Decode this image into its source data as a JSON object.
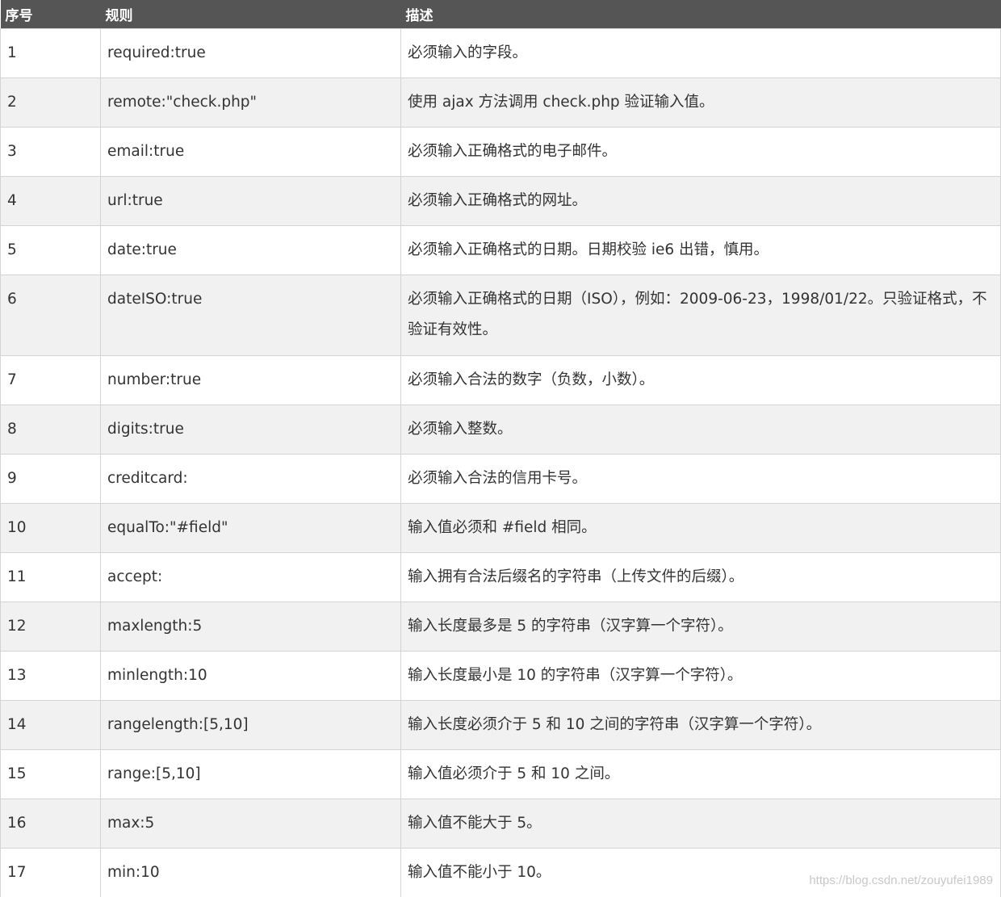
{
  "table": {
    "headers": [
      "序号",
      "规则",
      "描述"
    ],
    "rows": [
      {
        "num": "1",
        "rule": "required:true",
        "desc": "必须输入的字段。"
      },
      {
        "num": "2",
        "rule": "remote:\"check.php\"",
        "desc": "使用 ajax 方法调用 check.php 验证输入值。"
      },
      {
        "num": "3",
        "rule": "email:true",
        "desc": "必须输入正确格式的电子邮件。"
      },
      {
        "num": "4",
        "rule": "url:true",
        "desc": "必须输入正确格式的网址。"
      },
      {
        "num": "5",
        "rule": "date:true",
        "desc": "必须输入正确格式的日期。日期校验 ie6 出错，慎用。"
      },
      {
        "num": "6",
        "rule": "dateISO:true",
        "desc": "必须输入正确格式的日期（ISO），例如：2009-06-23，1998/01/22。只验证格式，不验证有效性。"
      },
      {
        "num": "7",
        "rule": "number:true",
        "desc": "必须输入合法的数字（负数，小数）。"
      },
      {
        "num": "8",
        "rule": "digits:true",
        "desc": "必须输入整数。"
      },
      {
        "num": "9",
        "rule": "creditcard:",
        "desc": "必须输入合法的信用卡号。"
      },
      {
        "num": "10",
        "rule": "equalTo:\"#field\"",
        "desc": "输入值必须和 #field 相同。"
      },
      {
        "num": "11",
        "rule": "accept:",
        "desc": "输入拥有合法后缀名的字符串（上传文件的后缀）。"
      },
      {
        "num": "12",
        "rule": "maxlength:5",
        "desc": "输入长度最多是 5 的字符串（汉字算一个字符）。"
      },
      {
        "num": "13",
        "rule": "minlength:10",
        "desc": "输入长度最小是 10 的字符串（汉字算一个字符）。"
      },
      {
        "num": "14",
        "rule": "rangelength:[5,10]",
        "desc": "输入长度必须介于 5 和 10 之间的字符串（汉字算一个字符）。"
      },
      {
        "num": "15",
        "rule": "range:[5,10]",
        "desc": "输入值必须介于 5 和 10 之间。"
      },
      {
        "num": "16",
        "rule": "max:5",
        "desc": "输入值不能大于 5。"
      },
      {
        "num": "17",
        "rule": "min:10",
        "desc": "输入值不能小于 10。"
      }
    ]
  },
  "watermark": "https://blog.csdn.net/zouyufei1989",
  "colors": {
    "header_bg": "#555555",
    "header_text": "#ffffff",
    "row_alt_bg": "#f1f1f1",
    "border": "#d4d4d4",
    "text": "#333333"
  }
}
